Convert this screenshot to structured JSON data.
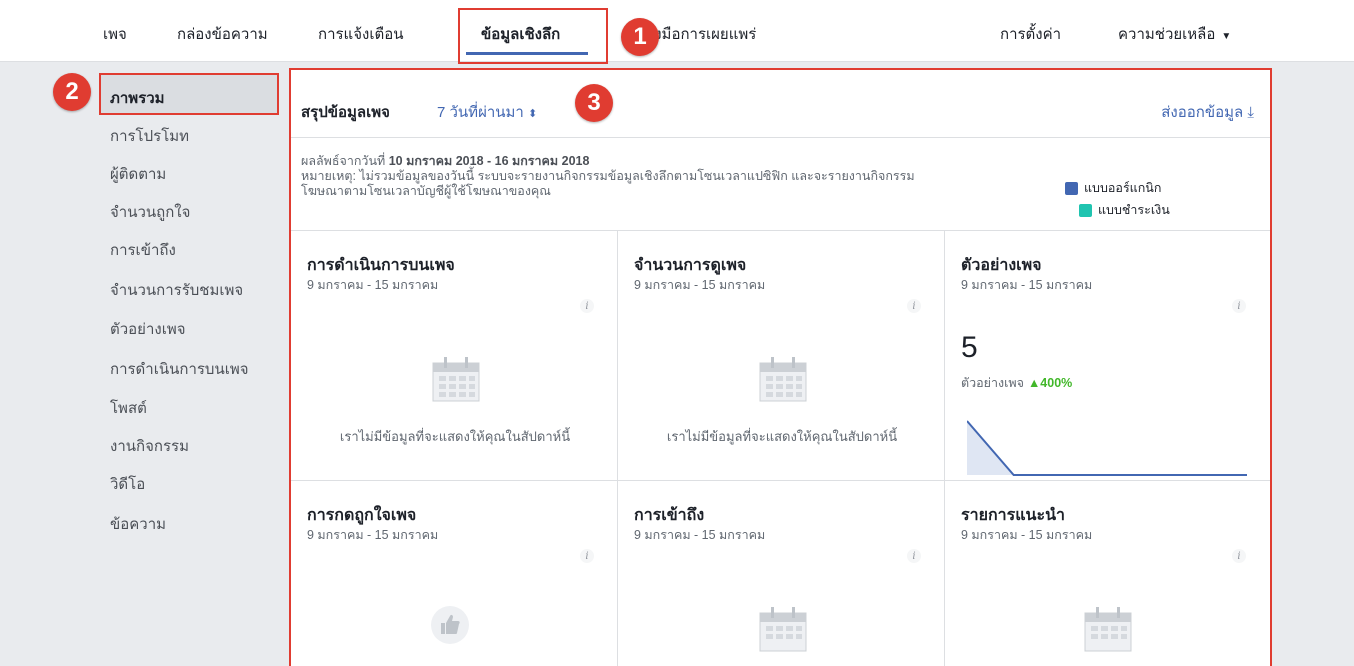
{
  "topnav": {
    "items": [
      {
        "label": "เพจ"
      },
      {
        "label": "กล่องข้อความ"
      },
      {
        "label": "การแจ้งเตือน"
      },
      {
        "label": "ข้อมูลเชิงลึก"
      },
      {
        "label": "เครื่องมือการเผยแพร่"
      }
    ],
    "settings_label": "การตั้งค่า",
    "help_label": "ความช่วยเหลือ",
    "help_caret": "▼"
  },
  "badges": {
    "one": "1",
    "two": "2",
    "three": "3"
  },
  "sidebar": {
    "items": [
      {
        "label": "ภาพรวม"
      },
      {
        "label": "การโปรโมท"
      },
      {
        "label": "ผู้ติดตาม"
      },
      {
        "label": "จำนวนถูกใจ"
      },
      {
        "label": "การเข้าถึง"
      },
      {
        "label": "จำนวนการรับชมเพจ"
      },
      {
        "label": "ตัวอย่างเพจ"
      },
      {
        "label": "การดำเนินการบนเพจ"
      },
      {
        "label": "โพสต์"
      },
      {
        "label": "งานกิจกรรม"
      },
      {
        "label": "วิดีโอ"
      },
      {
        "label": "ข้อความ"
      }
    ]
  },
  "summary": {
    "title": "สรุปข้อมูลเพจ",
    "range_label": "7 วันที่ผ่านมา",
    "range_caret": "⬍",
    "export_label": "ส่งออกข้อมูล",
    "export_icon": "⤓",
    "results_prefix": "ผลลัพธ์จากวันที่",
    "results_range": "10 มกราคม 2018 - 16 มกราคม 2018",
    "note_line1": "หมายเหตุ: ไม่รวมข้อมูลของวันนี้ ระบบจะรายงานกิจกรรมข้อมูลเชิงลึกตามโซนเวลาแปซิฟิก และจะรายงานกิจกรรม",
    "note_line2": "โฆษณาตามโซนเวลาบัญชีผู้ใช้โฆษณาของคุณ",
    "legend_organic": "แบบออร์แกนิก",
    "legend_paid": "แบบชำระเงิน",
    "colors": {
      "organic": "#4267b2",
      "paid": "#20c4b0"
    }
  },
  "cards": [
    {
      "title": "การดำเนินการบนเพจ",
      "date": "9 มกราคม - 15 มกราคม",
      "empty": "เราไม่มีข้อมูลที่จะแสดงให้คุณในสัปดาห์นี้"
    },
    {
      "title": "จำนวนการดูเพจ",
      "date": "9 มกราคม - 15 มกราคม",
      "empty": "เราไม่มีข้อมูลที่จะแสดงให้คุณในสัปดาห์นี้"
    },
    {
      "title": "ตัวอย่างเพจ",
      "date": "9 มกราคม - 15 มกราคม",
      "value": "5",
      "metric_label": "ตัวอย่างเพจ",
      "change": "▲400%"
    },
    {
      "title": "การกดถูกใจเพจ",
      "date": "9 มกราคม - 15 มกราคม"
    },
    {
      "title": "การเข้าถึง",
      "date": "9 มกราคม - 15 มกราคม"
    },
    {
      "title": "รายการแนะนำ",
      "date": "9 มกราคม - 15 มกราคม"
    }
  ],
  "info_glyph": "i",
  "sparkline": [
    5,
    0,
    0,
    0,
    0,
    0,
    0
  ]
}
